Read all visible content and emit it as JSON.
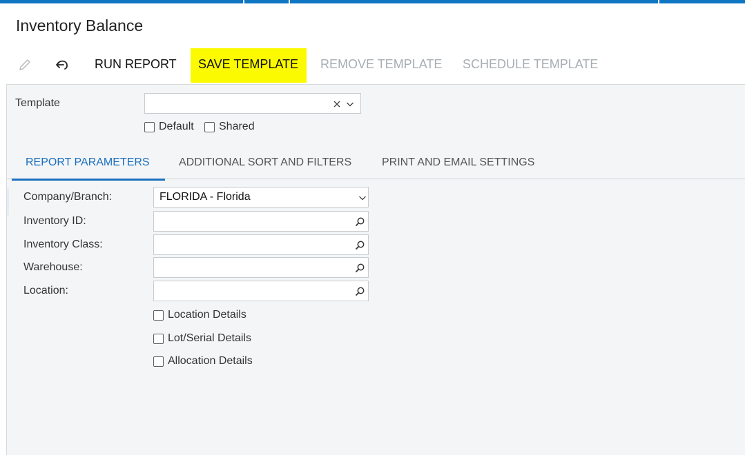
{
  "window": {
    "title": "Inventory Balance"
  },
  "toolbar": {
    "edit_icon": "pencil-icon",
    "undo_icon": "undo-icon",
    "run_report": "RUN REPORT",
    "save_template": "SAVE TEMPLATE",
    "remove_template": "REMOVE TEMPLATE",
    "schedule_template": "SCHEDULE TEMPLATE",
    "highlight_color": "#fbfa00"
  },
  "template": {
    "label": "Template",
    "value": "",
    "clear_icon": "close-icon",
    "dropdown_icon": "chevron-down-icon",
    "default_label": "Default",
    "default_checked": false,
    "shared_label": "Shared",
    "shared_checked": false
  },
  "tabs": [
    {
      "label": "REPORT PARAMETERS",
      "active": true
    },
    {
      "label": "ADDITIONAL SORT AND FILTERS",
      "active": false
    },
    {
      "label": "PRINT AND EMAIL SETTINGS",
      "active": false
    }
  ],
  "params": {
    "company_branch": {
      "label": "Company/Branch:",
      "value": "FLORIDA - Florida"
    },
    "inventory_id": {
      "label": "Inventory ID:",
      "value": ""
    },
    "inventory_class": {
      "label": "Inventory Class:",
      "value": ""
    },
    "warehouse": {
      "label": "Warehouse:",
      "value": ""
    },
    "location": {
      "label": "Location:",
      "value": ""
    },
    "location_details": {
      "label": "Location Details",
      "checked": false
    },
    "lot_serial_details": {
      "label": "Lot/Serial Details",
      "checked": false
    },
    "allocation_details": {
      "label": "Allocation Details",
      "checked": false
    }
  },
  "colors": {
    "accent": "#1a6fc0",
    "topbar": "#0f76c3",
    "disabled_text": "#a8adb3"
  }
}
